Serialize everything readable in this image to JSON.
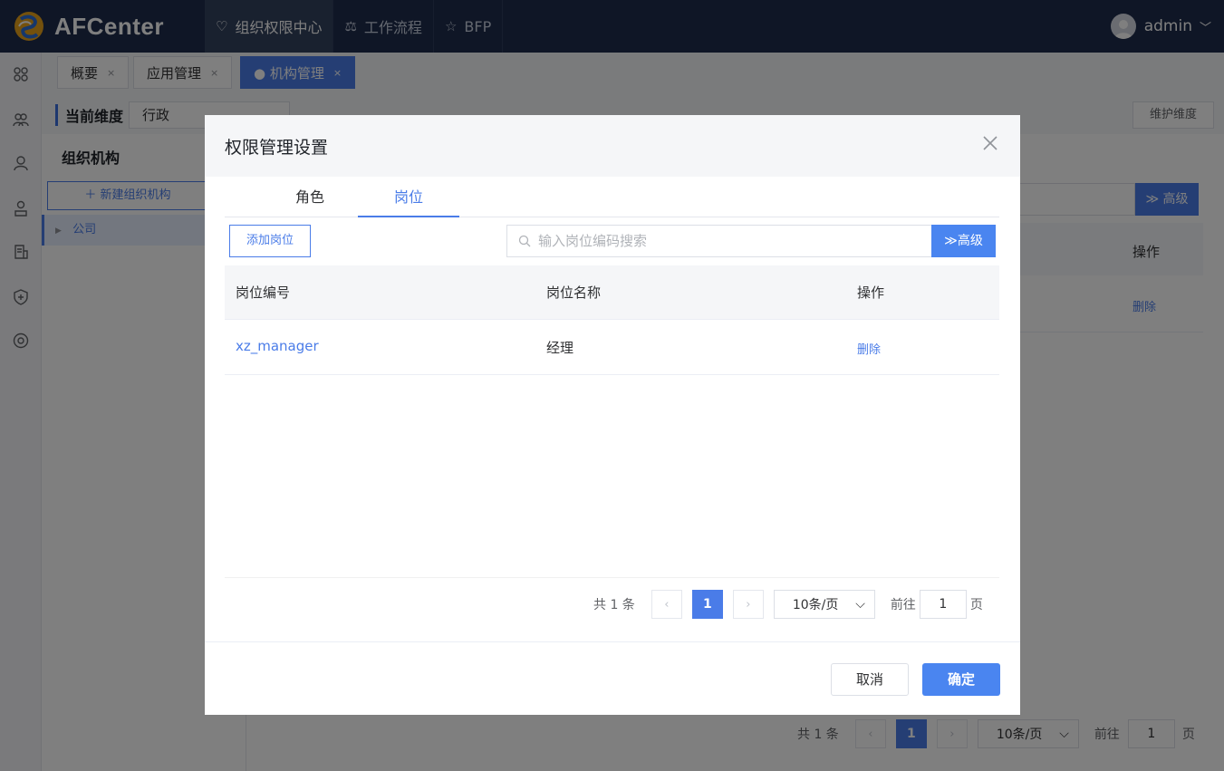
{
  "app": {
    "name": "AFCenter"
  },
  "topnav": [
    {
      "label": "组织权限中心",
      "icon": "shield-heart-icon",
      "active": true
    },
    {
      "label": "工作流程",
      "icon": "scale-icon",
      "active": false
    },
    {
      "label": "BFP",
      "icon": "star-icon",
      "active": false
    }
  ],
  "user": {
    "name": "admin"
  },
  "sidebar": {
    "icons": [
      "apps-icon",
      "users-group-icon",
      "user-icon",
      "user-badge-icon",
      "document-icon",
      "shield-plus-icon",
      "settings-ring-icon"
    ]
  },
  "tabs": [
    {
      "label": "概要",
      "close": "×"
    },
    {
      "label": "应用管理",
      "close": "×"
    },
    {
      "label": "● 机构管理",
      "close": "×",
      "active": true
    }
  ],
  "page": {
    "dimension_label": "当前维度",
    "dimension_value": "行政",
    "maintain_button": "维护维度",
    "org_title": "组织机构",
    "new_org_button": "＋ 新建组织机构",
    "tree_node": "公司",
    "advanced_button": "≫ 高级",
    "op_header": "操作",
    "delete_link": "删除",
    "pager": {
      "total": "共 1 条",
      "page": "1",
      "size": "10条/页",
      "goto_label": "前往",
      "goto_value": "1",
      "page_suffix": "页"
    }
  },
  "modal": {
    "title": "权限管理设置",
    "tabs": [
      {
        "label": "角色"
      },
      {
        "label": "岗位",
        "active": true
      }
    ],
    "add_button": "添加岗位",
    "search_placeholder": "输入岗位编码搜索",
    "advanced_button": "高级",
    "columns": [
      "岗位编号",
      "岗位名称",
      "操作"
    ],
    "rows": [
      {
        "code": "xz_manager",
        "name": "经理",
        "action": "删除"
      }
    ],
    "pager": {
      "total": "共 1 条",
      "page": "1",
      "size": "10条/页",
      "goto_label": "前往",
      "goto_value": "1",
      "page_suffix": "页"
    },
    "cancel_button": "取消",
    "ok_button": "确定"
  },
  "colors": {
    "topbar": "#1f2d4d",
    "accent": "#4a85f0",
    "link": "#4a7ce8"
  }
}
